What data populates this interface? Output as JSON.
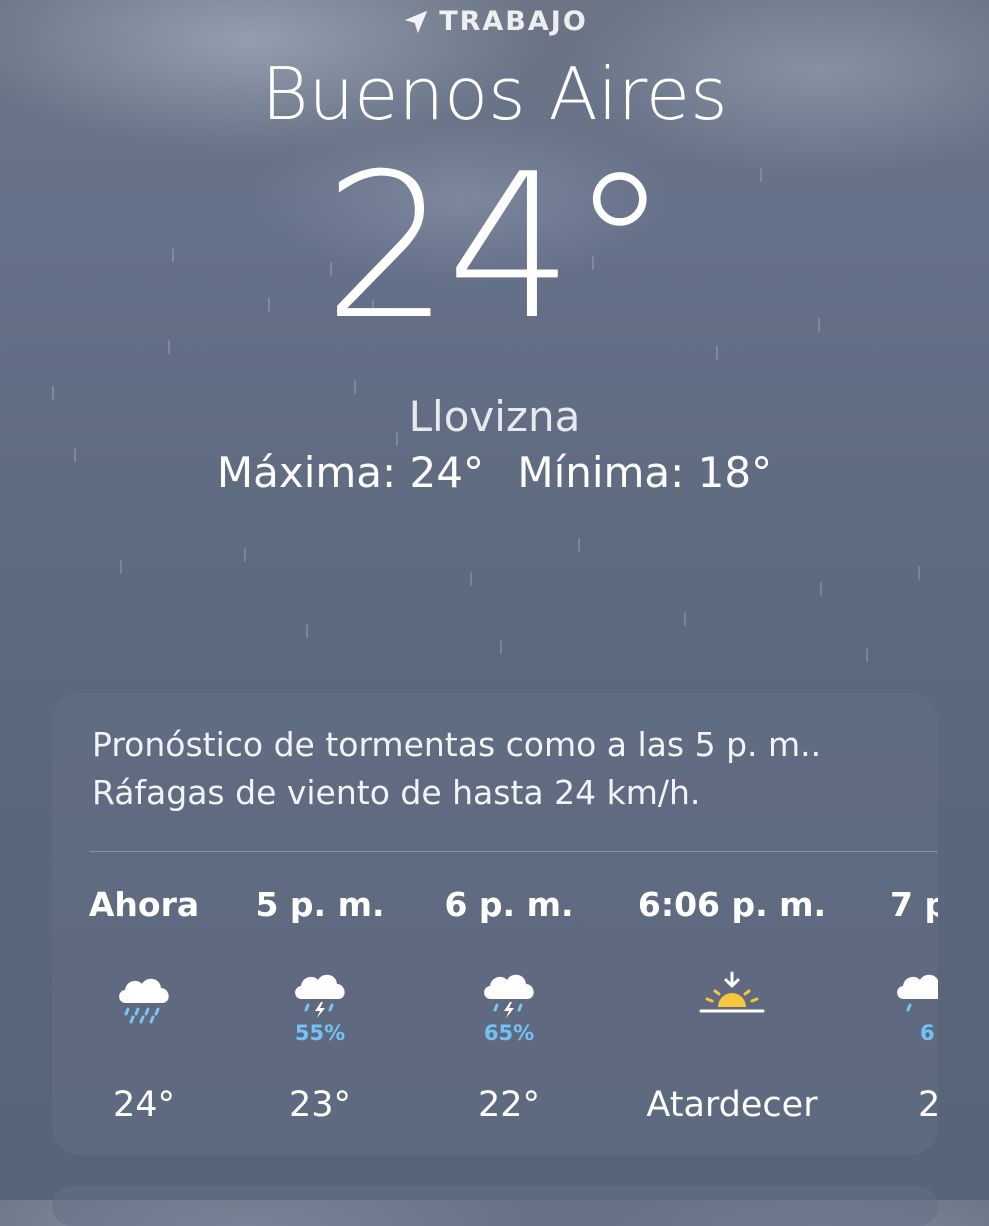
{
  "header": {
    "location_label": "TRABAJO",
    "city": "Buenos Aires",
    "temperature": "24°",
    "condition": "Llovizna",
    "high": "Máxima: 24°",
    "low": "Mínima: 18°"
  },
  "forecast_card": {
    "summary_line1": "Pronóstico de tormentas como a las 5 p. m..",
    "summary_line2": "Ráfagas de viento de hasta 24 km/h.",
    "hours": [
      {
        "time": "Ahora",
        "icon": "drizzle-cloud-icon",
        "precip": "",
        "temp": "24°"
      },
      {
        "time": "5 p. m.",
        "icon": "thunderstorm-cloud-icon",
        "precip": "55%",
        "temp": "23°"
      },
      {
        "time": "6 p. m.",
        "icon": "thunderstorm-cloud-icon",
        "precip": "65%",
        "temp": "22°"
      },
      {
        "time": "6:06 p. m.",
        "icon": "sunset-icon",
        "precip": "",
        "temp": "Atardecer"
      },
      {
        "time": "7 p",
        "icon": "thunderstorm-cloud-icon",
        "precip": "6",
        "temp": "2"
      }
    ]
  },
  "colors": {
    "precip_text": "#74c2f3",
    "sun": "#f6c73c",
    "rain": "#7cc4f4"
  }
}
